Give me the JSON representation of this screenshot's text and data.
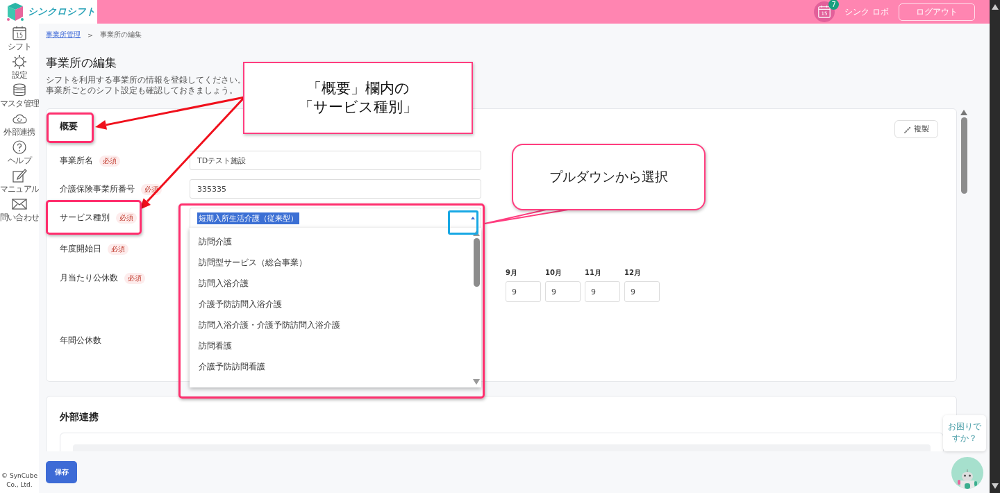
{
  "header": {
    "logo_text": "シンクロシフト",
    "notification": {
      "icon_text": "15",
      "count": "7"
    },
    "user_name": "シンク ロボ",
    "logout_button": "ログアウト"
  },
  "sidebar": {
    "items": [
      {
        "kind": "calendar",
        "icon_text": "15",
        "label": "シフト"
      },
      {
        "kind": "gear",
        "label": "設定"
      },
      {
        "kind": "database",
        "label": "マスタ管理"
      },
      {
        "kind": "cloud",
        "label": "外部連携"
      },
      {
        "kind": "help",
        "label": "ヘルプ"
      },
      {
        "kind": "edit",
        "label": "マニュアル"
      },
      {
        "kind": "mail",
        "label": "問い合わせ"
      }
    ],
    "copyright": "© SynCube Co., Ltd."
  },
  "breadcrumb": {
    "items": [
      {
        "kind": "link",
        "label": "事業所管理"
      },
      {
        "kind": "current",
        "label": "事業所の編集"
      }
    ],
    "separator": ">"
  },
  "page": {
    "title": "事業所の編集",
    "description": [
      "シフトを利用する事業所の情報を登録してください。",
      "事業所ごとのシフト設定も確認しておきましょう。"
    ]
  },
  "overview": {
    "title": "概要",
    "copy_button": "複製",
    "fields": [
      {
        "kind": "text",
        "label": "事業所名",
        "required": "必須",
        "value": "TDテスト施設"
      },
      {
        "kind": "text",
        "label": "介護保険事業所番号",
        "required": "必須",
        "value": "335335"
      },
      {
        "kind": "select",
        "label": "サービス種別",
        "required": "必須",
        "value": "短期入所生活介護（従来型）",
        "open": true,
        "options": [
          {
            "label": "訪問介護",
            "selected": false
          },
          {
            "label": "訪問型サービス（総合事業）",
            "selected": false
          },
          {
            "label": "訪問入浴介護",
            "selected": false
          },
          {
            "label": "介護予防訪問入浴介護",
            "selected": false
          },
          {
            "label": "訪問入浴介護・介護予防訪問入浴介護",
            "selected": false
          },
          {
            "label": "訪問看護",
            "selected": false
          },
          {
            "label": "介護予防訪問看護",
            "selected": false
          }
        ]
      },
      {
        "kind": "date",
        "label": "年度開始日",
        "required": "必須"
      },
      {
        "kind": "months",
        "label": "月当たり公休数",
        "required": "必須",
        "months": [
          {
            "label": "9月",
            "value": "9"
          },
          {
            "label": "10月",
            "value": "9"
          },
          {
            "label": "11月",
            "value": "9"
          },
          {
            "label": "12月",
            "value": "9"
          }
        ]
      },
      {
        "kind": "number",
        "label": "年間公休数"
      }
    ]
  },
  "external": {
    "title": "外部連携"
  },
  "save_button": "保存",
  "help": {
    "bubble": "お困りですか？"
  },
  "annotations": [
    {
      "kind": "callout",
      "lines": [
        "「概要」欄内の",
        "「サービス種別」"
      ]
    },
    {
      "kind": "speech",
      "text": "プルダウンから選択"
    }
  ]
}
